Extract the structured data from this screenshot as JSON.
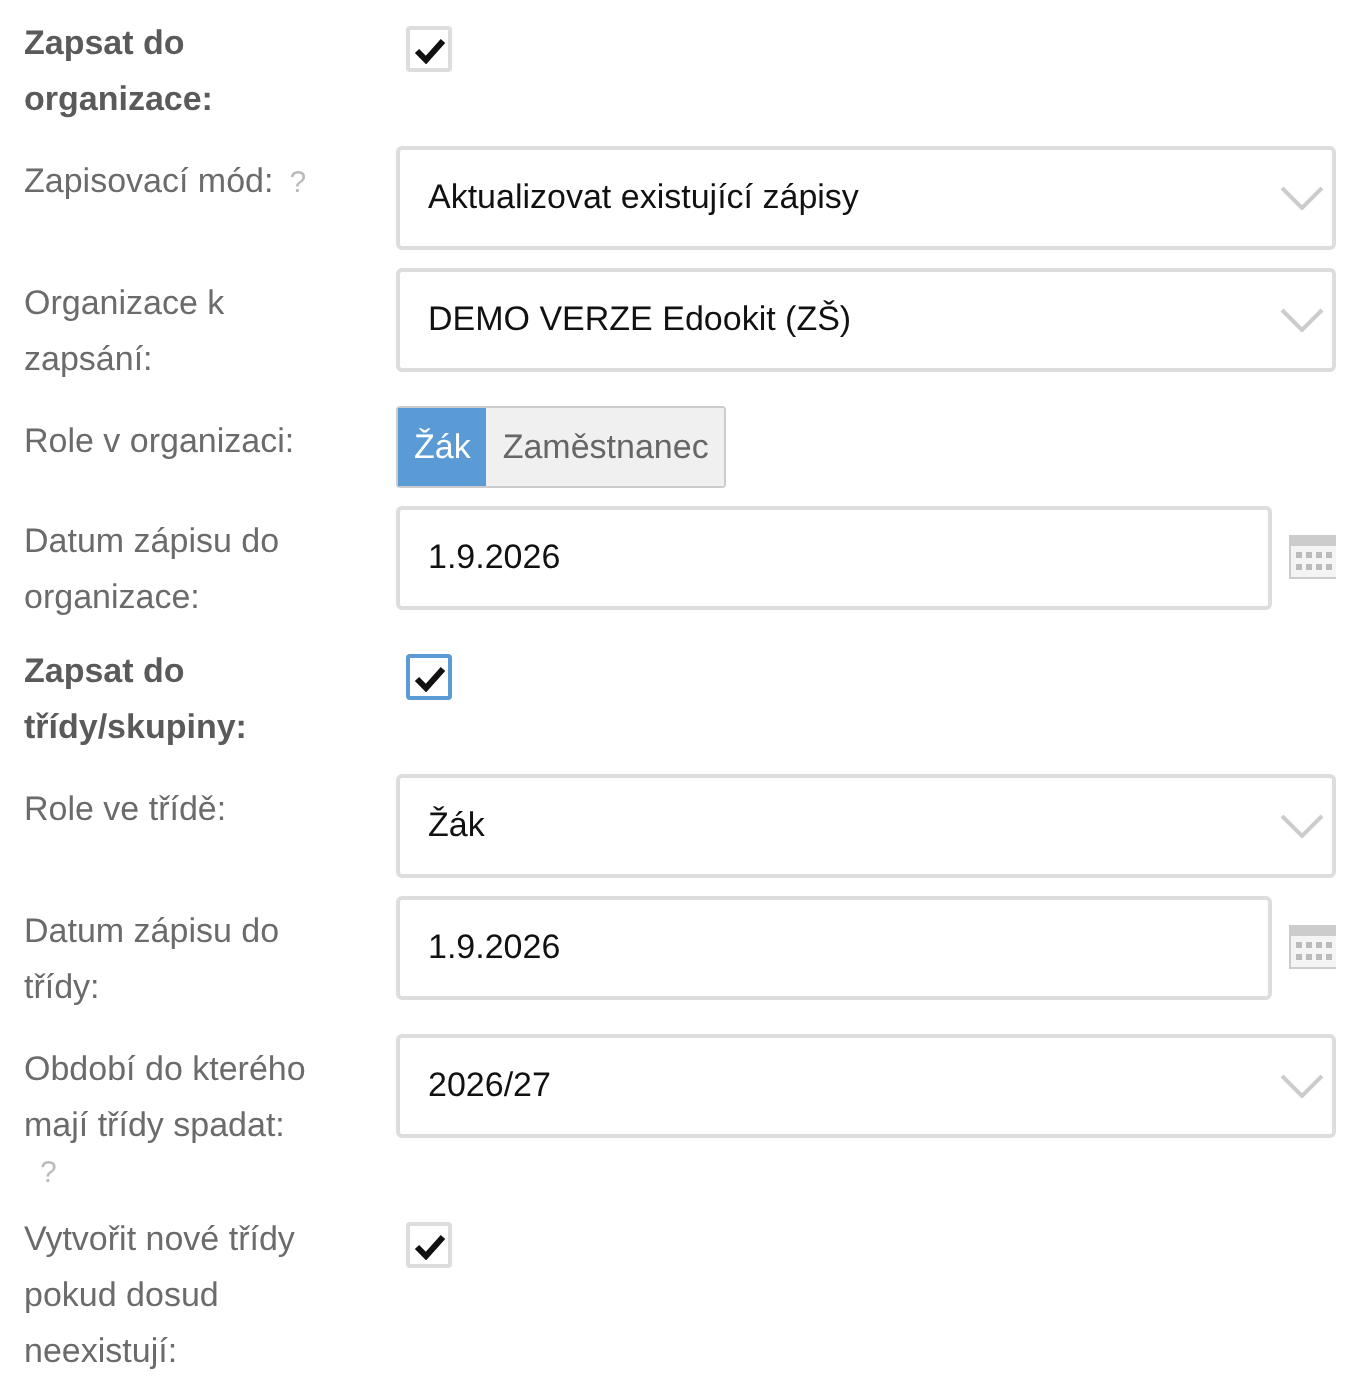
{
  "fields": [
    {
      "kind": "checkbox",
      "label": "Zapsat do organizace:",
      "strong": true,
      "checked": true,
      "focused": false
    },
    {
      "kind": "select",
      "label": "Zapisovací mód:",
      "help": "?",
      "value": "Aktualizovat existující zápisy"
    },
    {
      "kind": "select",
      "label": "Organizace k zapsání:",
      "value": "DEMO VERZE Edookit (ZŠ)"
    },
    {
      "kind": "segmented",
      "label": "Role v organizaci:",
      "options": [
        {
          "label": "Žák",
          "selected": true
        },
        {
          "label": "Zaměstnanec",
          "selected": false
        }
      ]
    },
    {
      "kind": "date",
      "label": "Datum zápisu do organizace:",
      "value": "1.9.2026"
    },
    {
      "kind": "checkbox",
      "label": "Zapsat do třídy/skupiny:",
      "strong": true,
      "checked": true,
      "focused": true
    },
    {
      "kind": "select",
      "label": "Role ve třídě:",
      "value": "Žák"
    },
    {
      "kind": "date",
      "label": "Datum zápisu do třídy:",
      "value": "1.9.2026"
    },
    {
      "kind": "select",
      "label": "Období do kterého mají třídy spadat:",
      "help": "?",
      "value": "2026/27"
    },
    {
      "kind": "checkbox",
      "label": "Vytvořit nové třídy pokud dosud neexistují:",
      "strong": false,
      "checked": true,
      "focused": false
    }
  ]
}
